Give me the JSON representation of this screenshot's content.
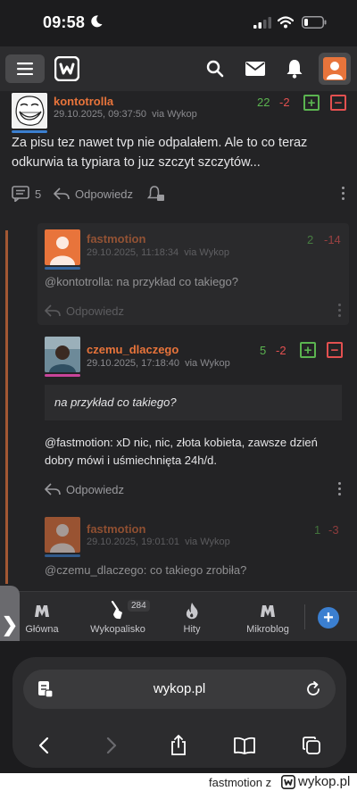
{
  "status_bar": {
    "time": "09:58"
  },
  "header": {
    "menu_icon": "hamburger-icon",
    "logo_icon": "wykop-logo",
    "search_icon": "search-icon",
    "mail_icon": "mail-icon",
    "bell_icon": "bell-icon"
  },
  "main_entry": {
    "author": "kontotrolla",
    "date": "29.10.2025, 09:37:50",
    "via": "via Wykop",
    "votes_up": "22",
    "votes_down": "-2",
    "text": "Za pisu tez nawet tvp nie odpalałem. Ale to co teraz odkurwia ta typiara to juz szczyt szczytów...",
    "comment_count": "5",
    "reply_label": "Odpowiedz"
  },
  "comments": [
    {
      "author": "fastmotion",
      "date": "29.10.2025, 11:18:34",
      "via": "via Wykop",
      "votes_up": "2",
      "votes_down": "-14",
      "mention": "@kontotrolla",
      "text": ": na przykład co takiego?",
      "reply_label": "Odpowiedz"
    },
    {
      "author": "czemu_dlaczego",
      "date": "29.10.2025, 17:18:40",
      "via": "via Wykop",
      "votes_up": "5",
      "votes_down": "-2",
      "quote": "na przykład co takiego?",
      "mention": "@fastmotion",
      "text": ": xD nic, nic, złota kobieta, zawsze dzień dobry mówi i uśmiechnięta 24h/d.",
      "reply_label": "Odpowiedz"
    },
    {
      "author": "fastmotion",
      "date": "29.10.2025, 19:01:01",
      "via": "via Wykop",
      "votes_up": "1",
      "votes_down": "-3",
      "mention": "@czemu_dlaczego",
      "text": ": co takiego zrobiła?"
    }
  ],
  "bottom_nav": {
    "items": [
      {
        "label": "Główna",
        "icon": "home-icon"
      },
      {
        "label": "Wykopalisko",
        "icon": "shovel-icon",
        "badge": "284"
      },
      {
        "label": "Hity",
        "icon": "fire-icon"
      },
      {
        "label": "Mikroblog",
        "icon": "mikroblog-icon"
      }
    ],
    "add_label": "+"
  },
  "browser": {
    "url": "wykop.pl"
  },
  "footer": {
    "user": "fastmotion",
    "separator": "z",
    "site": "wykop.pl"
  },
  "colors": {
    "accent": "#e8743b",
    "vote_positive": "#5bb450",
    "vote_negative": "#e35050",
    "link": "#3b7fd0"
  }
}
